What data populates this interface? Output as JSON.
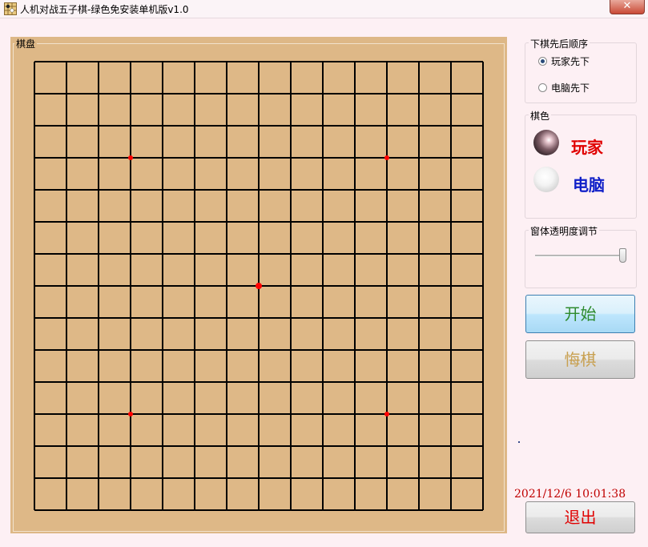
{
  "window": {
    "title": "人机对战五子棋-绿色免安装单机版v1.0",
    "close_glyph": "✕"
  },
  "board": {
    "label": "棋盘",
    "lines": 15,
    "star_points": [
      [
        3,
        3
      ],
      [
        11,
        3
      ],
      [
        7,
        7
      ],
      [
        3,
        11
      ],
      [
        11,
        11
      ]
    ],
    "colors": {
      "background": "#deb887",
      "line": "#000000",
      "star": "#ff0000"
    }
  },
  "order_group": {
    "label": "下棋先后顺序",
    "options": [
      {
        "label": "玩家先下",
        "checked": true
      },
      {
        "label": "电脑先下",
        "checked": false
      }
    ]
  },
  "color_group": {
    "label": "棋色",
    "player_label": "玩家",
    "computer_label": "电脑",
    "player_color": "#e00000",
    "computer_color": "#1020c8"
  },
  "opacity_group": {
    "label": "窗体透明度调节",
    "value": 1.0
  },
  "buttons": {
    "start_label": "开始",
    "undo_label": "悔棋",
    "exit_label": "退出",
    "start_color": "#2e8b2e",
    "undo_color": "#c8a050",
    "exit_color": "#e00000"
  },
  "clock": "2021/12/6 10:01:38"
}
